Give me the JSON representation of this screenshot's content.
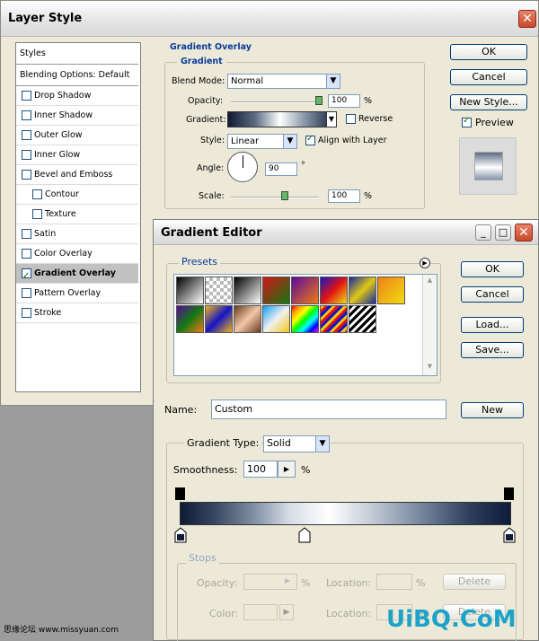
{
  "layer_style": {
    "title": "Layer Style",
    "styles_header": "Styles",
    "blending_options": "Blending Options: Default",
    "style_items": [
      {
        "label": "Drop Shadow",
        "checked": false,
        "indent": false
      },
      {
        "label": "Inner Shadow",
        "checked": false,
        "indent": false
      },
      {
        "label": "Outer Glow",
        "checked": false,
        "indent": false
      },
      {
        "label": "Inner Glow",
        "checked": false,
        "indent": false
      },
      {
        "label": "Bevel and Emboss",
        "checked": false,
        "indent": false
      },
      {
        "label": "Contour",
        "checked": false,
        "indent": true
      },
      {
        "label": "Texture",
        "checked": false,
        "indent": true
      },
      {
        "label": "Satin",
        "checked": false,
        "indent": false
      },
      {
        "label": "Color Overlay",
        "checked": false,
        "indent": false
      },
      {
        "label": "Gradient Overlay",
        "checked": true,
        "indent": false,
        "selected": true
      },
      {
        "label": "Pattern Overlay",
        "checked": false,
        "indent": false
      },
      {
        "label": "Stroke",
        "checked": false,
        "indent": false
      }
    ],
    "buttons": {
      "ok": "OK",
      "cancel": "Cancel",
      "new_style": "New Style...",
      "preview": "Preview"
    },
    "gradient_overlay": {
      "section_title": "Gradient Overlay",
      "group_title": "Gradient",
      "blend_mode_label": "Blend Mode:",
      "blend_mode_value": "Normal",
      "opacity_label": "Opacity:",
      "opacity_value": "100",
      "opacity_unit": "%",
      "gradient_label": "Gradient:",
      "reverse_label": "Reverse",
      "style_label": "Style:",
      "style_value": "Linear",
      "align_label": "Align with Layer",
      "angle_label": "Angle:",
      "angle_value": "90",
      "angle_unit": "°",
      "scale_label": "Scale:",
      "scale_value": "100",
      "scale_unit": "%"
    }
  },
  "gradient_editor": {
    "title": "Gradient Editor",
    "presets_label": "Presets",
    "buttons": {
      "ok": "OK",
      "cancel": "Cancel",
      "load": "Load...",
      "save": "Save...",
      "new": "New"
    },
    "name_label": "Name:",
    "name_value": "Custom",
    "gradient_type_label": "Gradient Type:",
    "gradient_type_value": "Solid",
    "smoothness_label": "Smoothness:",
    "smoothness_value": "100",
    "smoothness_unit": "%",
    "stops": {
      "group_title": "Stops",
      "opacity_label": "Opacity:",
      "opacity_unit": "%",
      "location_label": "Location:",
      "location_unit": "%",
      "color_label": "Color:",
      "delete_label": "Delete"
    }
  },
  "watermark": {
    "left": "思缘论坛 www.missyuan.com",
    "right": "UiBQ.CoM"
  }
}
